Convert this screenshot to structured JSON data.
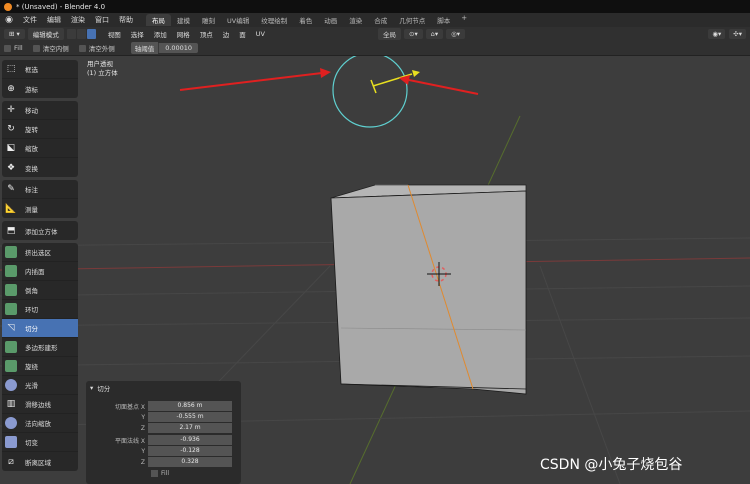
{
  "titlebar": {
    "title": "* (Unsaved) - Blender 4.0"
  },
  "menubar": {
    "items": [
      "文件",
      "编辑",
      "渲染",
      "窗口",
      "帮助"
    ],
    "workspaces": [
      "布局",
      "建模",
      "雕刻",
      "UV编辑",
      "纹理绘制",
      "着色",
      "动画",
      "渲染",
      "合成",
      "几何节点",
      "脚本"
    ],
    "active_workspace": "布局",
    "add_label": "+"
  },
  "header": {
    "mode": "编辑模式",
    "menus": [
      "视图",
      "选择",
      "添加",
      "网格",
      "顶点",
      "边",
      "面",
      "UV"
    ],
    "transform": "全局"
  },
  "tool_header": {
    "fill_label": "Fill",
    "clear_inner_label": "清空内侧",
    "clear_outer_label": "清空外侧",
    "threshold_label": "轴阈值",
    "threshold_value": "0.00010"
  },
  "toolbar": {
    "groups": [
      [
        "框选",
        "游标"
      ],
      [
        "移动",
        "旋转",
        "缩放",
        "变换"
      ],
      [
        "标注",
        "测量"
      ],
      [
        "添加立方体"
      ],
      [
        "挤出选区",
        "内插面",
        "倒角",
        "环切",
        "切分",
        "多边形建形",
        "旋绕",
        "光滑",
        "滑移边线",
        "法向缩放",
        "切变",
        "断离区域"
      ]
    ],
    "active": "切分"
  },
  "viewport": {
    "view_name": "用户透视",
    "object_name": "(1) 立方体"
  },
  "operator_panel": {
    "title": "切分",
    "plane_point_label": "切面基点",
    "plane_normal_label": "平面法线",
    "axis_x": "X",
    "axis_y": "Y",
    "axis_z": "Z",
    "plane_point": [
      "0.856 m",
      "-0.555 m",
      "2.17 m"
    ],
    "plane_normal": [
      "-0.936",
      "-0.128",
      "0.328"
    ],
    "fill_label": "Fill"
  },
  "watermark": "CSDN @小兔子烧包谷",
  "colors": {
    "viewport_bg": "#3d3d3d",
    "active_blue": "#4772b3",
    "gizmo_circle": "#5fd0d0",
    "gizmo_arrow": "#e8e020",
    "annotation_arrow": "#e02020",
    "cube_face": "#a9a9a9"
  }
}
